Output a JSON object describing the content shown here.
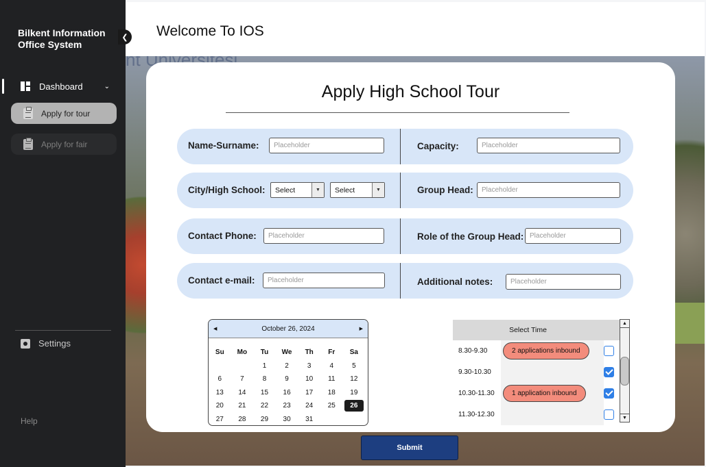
{
  "sidebar": {
    "brand_line1": "Bilkent Information",
    "brand_line2": "Office System",
    "collapse_icon": "chevron-left-icon",
    "dashboard_label": "Dashboard",
    "items": [
      {
        "label": "Apply for tour",
        "active": true
      },
      {
        "label": "Apply for fair",
        "active": false
      }
    ],
    "settings_label": "Settings",
    "help_label": "Help"
  },
  "header": {
    "title": "Welcome To IOS"
  },
  "form": {
    "title": "Apply High School Tour",
    "fields": {
      "name_label": "Name-Surname:",
      "capacity_label": "Capacity:",
      "city_school_label": "City/High School:",
      "group_head_label": "Group Head:",
      "phone_label": "Contact Phone:",
      "role_label": "Role of the Group Head:",
      "email_label": "Contact e-mail:",
      "notes_label": "Additional notes:",
      "placeholder": "Placeholder",
      "city_select": "Select",
      "school_select": "Select"
    }
  },
  "calendar": {
    "month_label": "October 26, 2024",
    "weekdays": [
      "Su",
      "Mo",
      "Tu",
      "We",
      "Th",
      "Fr",
      "Sa"
    ],
    "weeks": [
      [
        "",
        "",
        "1",
        "2",
        "3",
        "4",
        "5"
      ],
      [
        "6",
        "7",
        "8",
        "9",
        "10",
        "11",
        "12"
      ],
      [
        "13",
        "14",
        "15",
        "16",
        "17",
        "18",
        "19"
      ],
      [
        "20",
        "21",
        "22",
        "23",
        "24",
        "25",
        "26"
      ],
      [
        "27",
        "28",
        "29",
        "30",
        "31",
        "",
        ""
      ]
    ],
    "selected_day": "26"
  },
  "time_select": {
    "header": "Select Time",
    "slots": [
      {
        "time": "8.30-9.30",
        "badge": "2 applications inbound",
        "checked": false
      },
      {
        "time": "9.30-10.30",
        "badge": "",
        "checked": true
      },
      {
        "time": "10.30-11.30",
        "badge": "1 application inbound",
        "checked": true
      },
      {
        "time": "11.30-12.30",
        "badge": "",
        "checked": false
      }
    ]
  },
  "submit_label": "Submit",
  "colors": {
    "sidebar_bg": "#202123",
    "row_bg": "#d8e6f8",
    "badge_bg": "#f38c7c",
    "checkbox": "#2f7fe6",
    "submit_bg": "#1d3e80"
  }
}
